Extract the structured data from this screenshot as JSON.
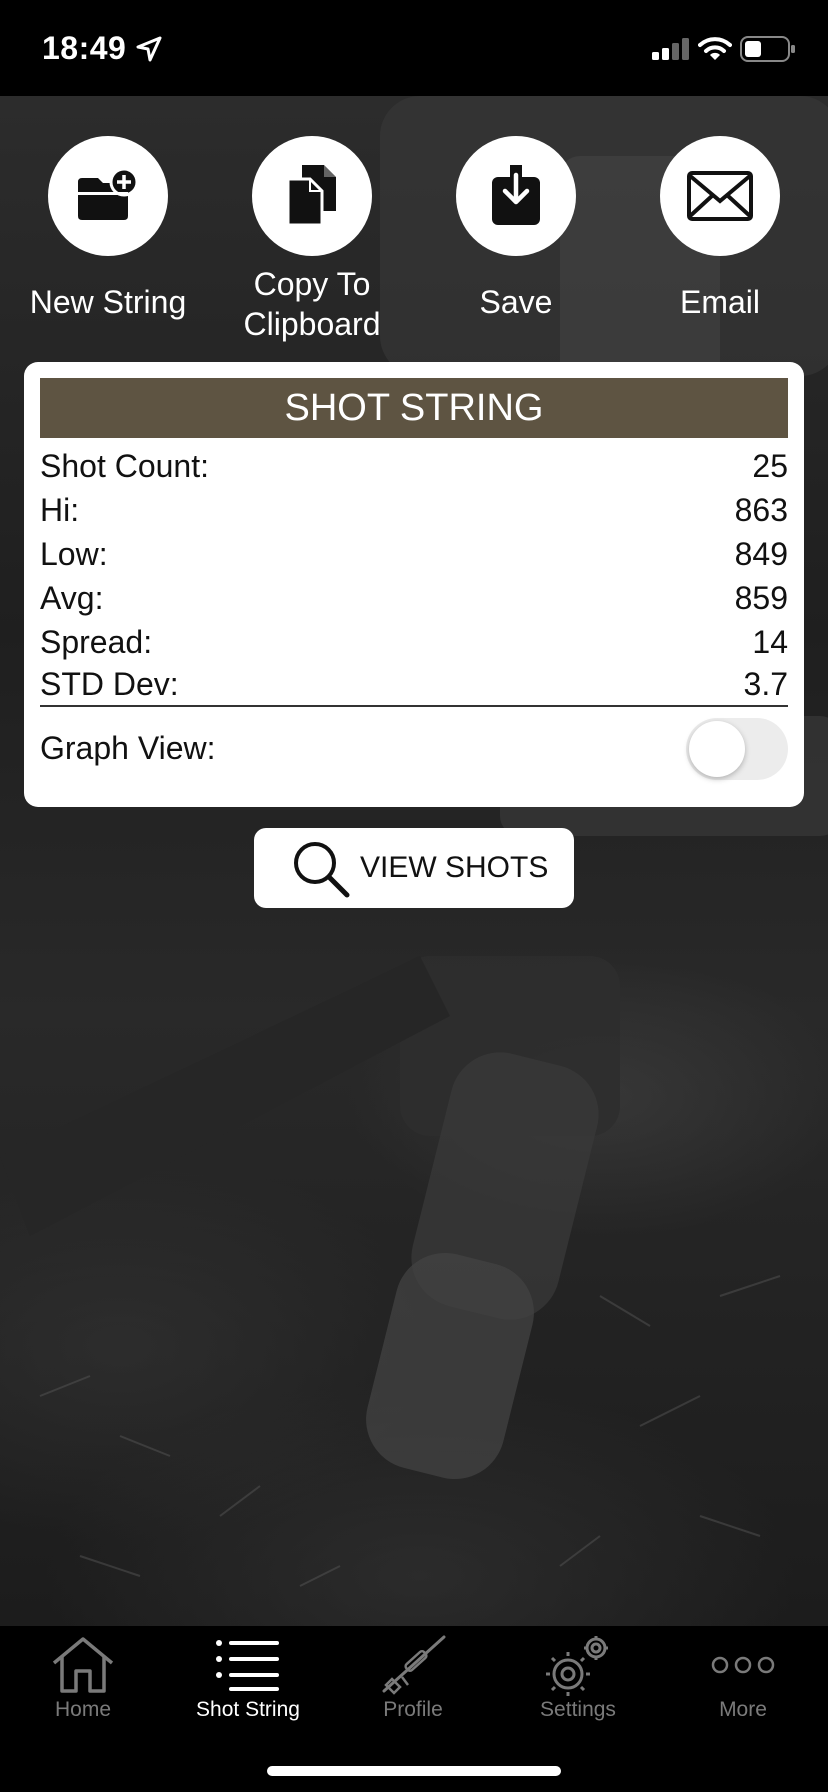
{
  "status_bar": {
    "time": "18:49",
    "location_icon": "location-arrow-icon",
    "signal_icon": "cellular-signal-icon",
    "wifi_icon": "wifi-icon",
    "battery_icon": "battery-icon"
  },
  "actions": [
    {
      "label": "New String",
      "icon": "folder-add-icon"
    },
    {
      "label": "Copy To\nClipboard",
      "icon": "copy-documents-icon"
    },
    {
      "label": "Save",
      "icon": "download-save-icon"
    },
    {
      "label": "Email",
      "icon": "envelope-icon"
    }
  ],
  "card": {
    "title": "SHOT STRING",
    "header_color": "#5e5442",
    "stats": [
      {
        "label": "Shot Count:",
        "value": "25"
      },
      {
        "label": "Hi:",
        "value": "863"
      },
      {
        "label": "Low:",
        "value": "849"
      },
      {
        "label": "Avg:",
        "value": "859"
      },
      {
        "label": "Spread:",
        "value": "14"
      },
      {
        "label": "STD Dev:",
        "value": "3.7"
      }
    ],
    "graph_view_label": "Graph View:",
    "graph_view_on": false
  },
  "view_shots_label": "VIEW SHOTS",
  "tabs": [
    {
      "label": "Home",
      "icon": "home-icon",
      "active": false
    },
    {
      "label": "Shot String",
      "icon": "list-icon",
      "active": true
    },
    {
      "label": "Profile",
      "icon": "rifle-icon",
      "active": false
    },
    {
      "label": "Settings",
      "icon": "gears-icon",
      "active": false
    },
    {
      "label": "More",
      "icon": "more-dots-icon",
      "active": false
    }
  ]
}
